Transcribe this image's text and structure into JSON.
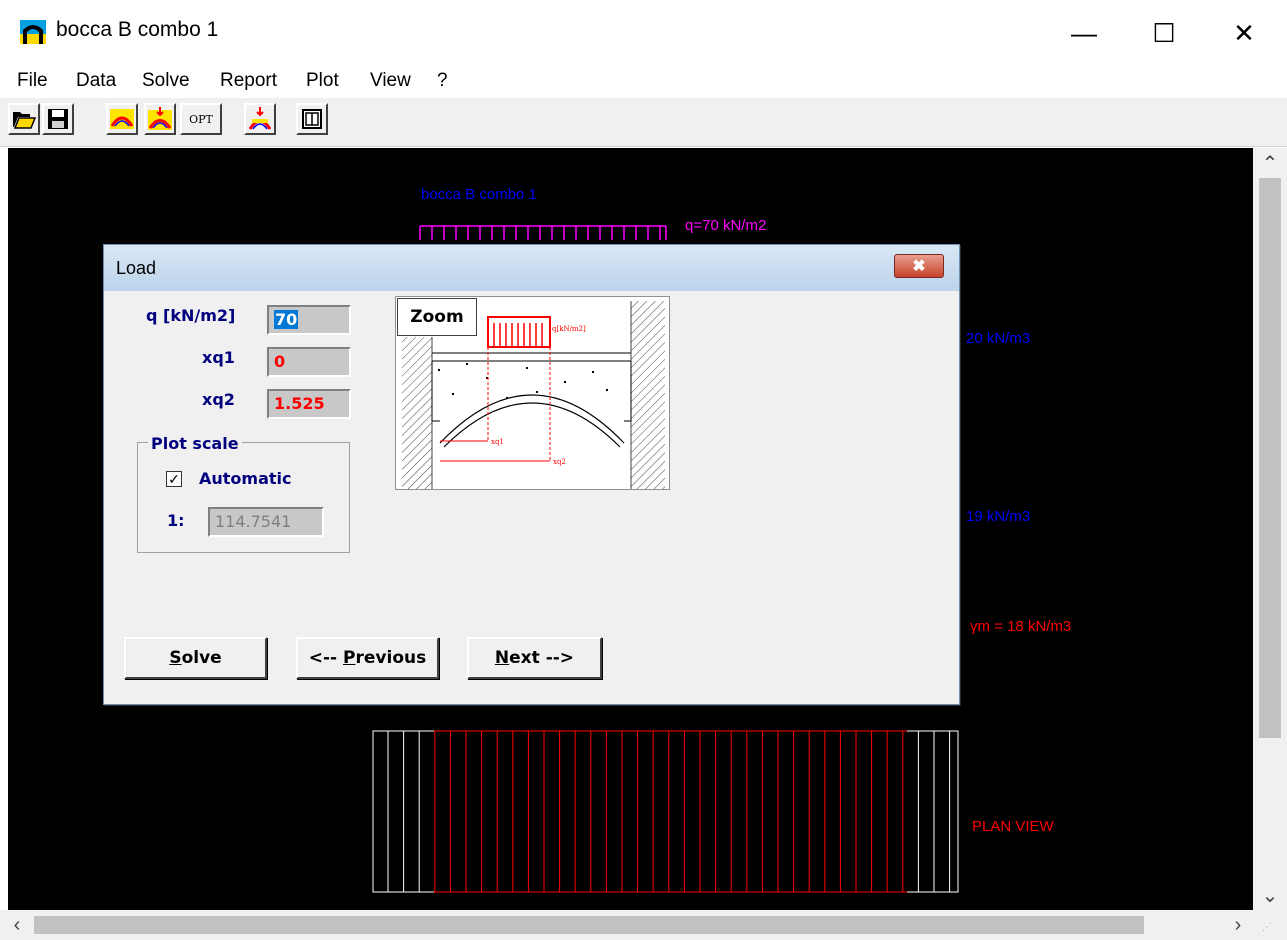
{
  "window": {
    "title": "bocca B combo 1",
    "minimize": "—",
    "maximize": "☐",
    "close": "✕"
  },
  "menu": [
    "File",
    "Data",
    "Solve",
    "Report",
    "Plot",
    "View",
    "?"
  ],
  "toolbar": {
    "opt_label": "OPT"
  },
  "canvas": {
    "plot_title": "bocca B combo 1",
    "load_label": "q=70 kN/m2",
    "gamma_label_1": "20 kN/m3",
    "gamma_label_2": "19 kN/m3",
    "gamma_label_3": "γm = 18 kN/m3",
    "plan_view_label": "PLAN VIEW",
    "colors": {
      "background": "#000000",
      "load": "#ff00ff",
      "text_blue": "#0000ff",
      "red": "#ff0000"
    }
  },
  "dialog": {
    "title": "Load",
    "close_label": "✖",
    "fields": {
      "q_label": "q [kN/m2]",
      "q_value": "70",
      "xq1_label": "xq1",
      "xq1_value": "0",
      "xq2_label": "xq2",
      "xq2_value": "1.525"
    },
    "plot_scale": {
      "group_label": "Plot scale",
      "automatic_label": "Automatic",
      "automatic_checked": true,
      "scale_prefix": "1:",
      "scale_value": "114.7541"
    },
    "preview": {
      "zoom_label": "Zoom",
      "load_tag": "q[kN/m2]",
      "xq1_tag": "xq1",
      "xq2_tag": "xq2"
    },
    "buttons": {
      "solve_prefix": "",
      "solve_key": "S",
      "solve_rest": "olve",
      "prev_prefix": "<-- ",
      "prev_key": "P",
      "prev_rest": "revious",
      "next_prefix": "",
      "next_key": "N",
      "next_rest": "ext -->"
    }
  }
}
